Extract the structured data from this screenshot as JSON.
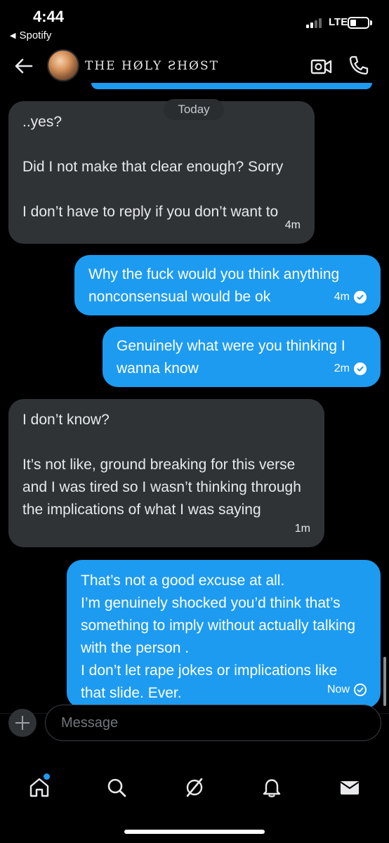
{
  "status_bar": {
    "time": "4:44",
    "back_app": "Spotify",
    "network": "LTE"
  },
  "header": {
    "contact_name": "THE HØLY ƧHØST",
    "icons": [
      "back-arrow-icon",
      "avatar",
      "video-call-icon",
      "phone-call-icon"
    ]
  },
  "date_separator": "Today",
  "messages": [
    {
      "direction": "incoming",
      "paragraphs": [
        "..yes?",
        "Did I not make that clear enough? Sorry",
        "I don’t have to reply if you don’t want to"
      ],
      "time": "4m"
    },
    {
      "direction": "outgoing",
      "lines": [
        "Why the fuck would you think anything",
        "nonconsensual would be ok"
      ],
      "time": "4m",
      "status": "sent-check"
    },
    {
      "direction": "outgoing",
      "lines": [
        "Genuinely what were you thinking I",
        "wanna know"
      ],
      "time": "2m",
      "status": "sent-check"
    },
    {
      "direction": "incoming",
      "paragraphs": [
        "I don’t know?",
        "It’s not like, ground breaking for this verse and I was tired so I wasn’t thinking through the implications of what I was saying"
      ],
      "time": "1m"
    },
    {
      "direction": "outgoing",
      "lines": [
        "That’s not a good excuse at all.",
        "I’m genuinely shocked you’d think that’s something to imply without actually talking with the person .",
        "I don’t let rape jokes or implications like that slide. Ever."
      ],
      "time": "Now",
      "status": "sending-circle"
    }
  ],
  "compose": {
    "placeholder": "Message"
  },
  "bottom_nav": {
    "items": [
      "home-icon",
      "search-icon",
      "grok-icon",
      "notifications-bell-icon",
      "messages-envelope-icon"
    ],
    "accent": "#1d9bf0"
  },
  "colors": {
    "outgoing_bubble": "#1d9bf0",
    "incoming_bubble": "#2f3336",
    "background": "#000000"
  }
}
